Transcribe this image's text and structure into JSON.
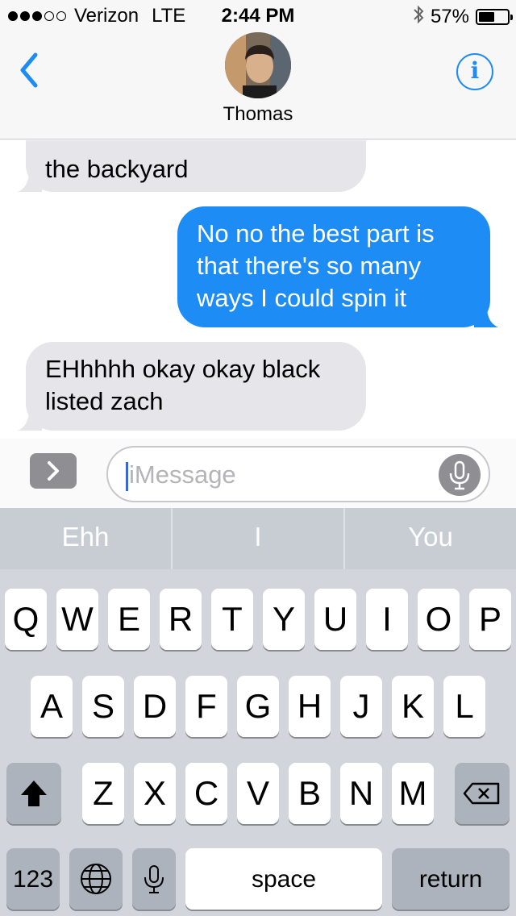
{
  "status": {
    "carrier": "Verizon",
    "network": "LTE",
    "time": "2:44 PM",
    "battery": "57%",
    "battery_level": 0.57,
    "signal_bars_filled": 3,
    "signal_bars_total": 5
  },
  "header": {
    "contact_name": "Thomas",
    "info_glyph": "i"
  },
  "messages": [
    {
      "direction": "received",
      "text": "the backyard"
    },
    {
      "direction": "sent",
      "lines": [
        "No no the best part is",
        "that there's so many",
        "ways I could spin it"
      ]
    },
    {
      "direction": "received",
      "lines": [
        "EHhhhh okay okay black",
        "listed zach"
      ]
    }
  ],
  "compose": {
    "placeholder": "iMessage"
  },
  "suggestions": [
    "Ehh",
    "I",
    "You"
  ],
  "keyboard": {
    "row1": [
      "Q",
      "W",
      "E",
      "R",
      "T",
      "Y",
      "U",
      "I",
      "O",
      "P"
    ],
    "row2": [
      "A",
      "S",
      "D",
      "F",
      "G",
      "H",
      "J",
      "K",
      "L"
    ],
    "row3": [
      "Z",
      "X",
      "C",
      "V",
      "B",
      "N",
      "M"
    ],
    "numbers_label": "123",
    "space_label": "space",
    "return_label": "return"
  },
  "colors": {
    "accent": "#1e8cf5",
    "incoming_bubble": "#e5e5ea",
    "keyboard_bg": "#d2d5db"
  }
}
